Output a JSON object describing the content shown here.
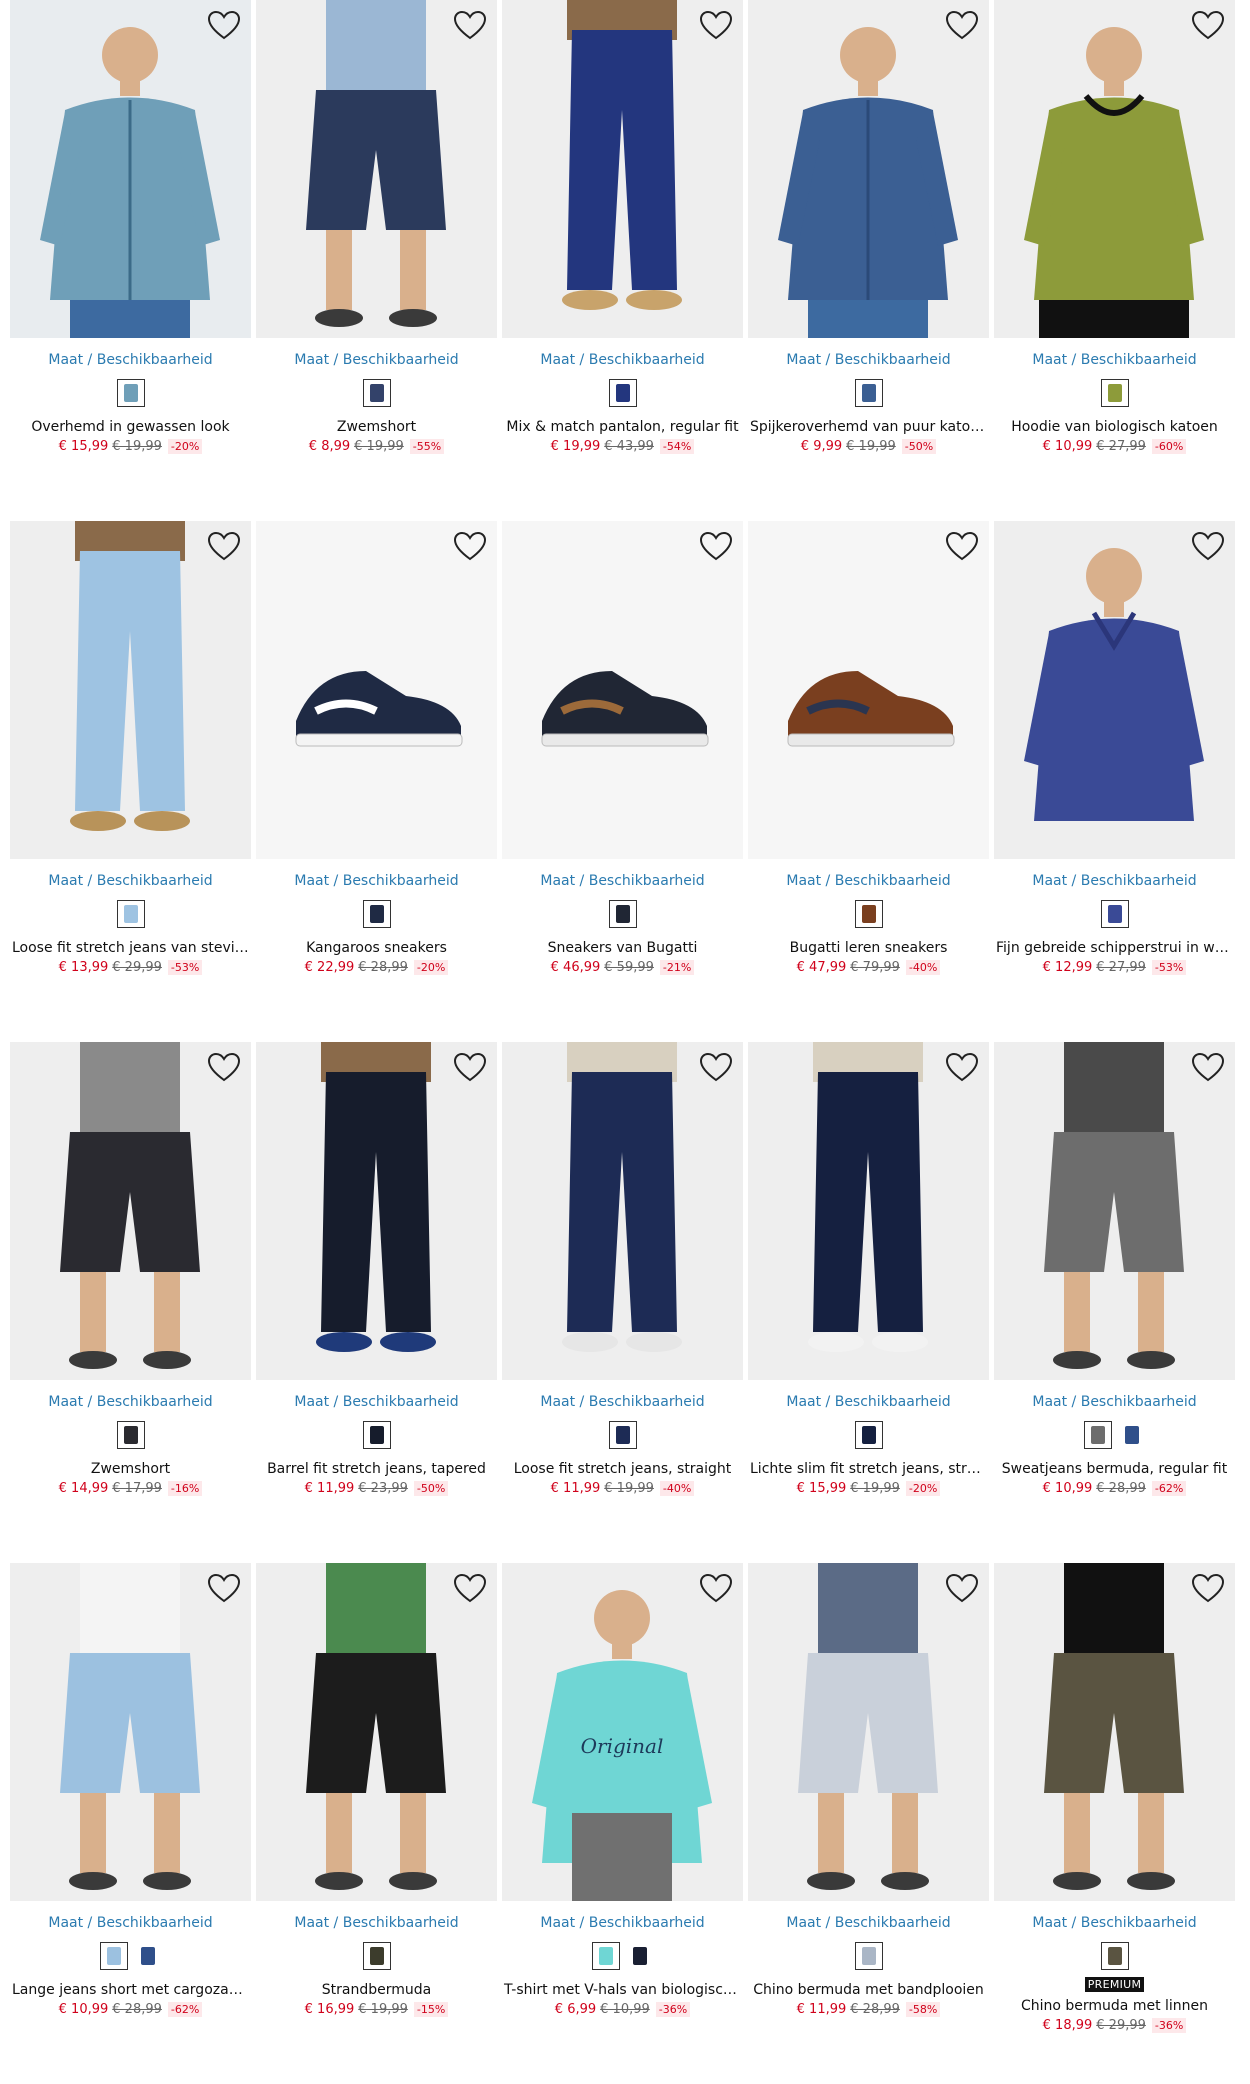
{
  "common": {
    "size_label": "Maat / Beschikbaarheid"
  },
  "products": [
    {
      "name": "Overhemd in gewassen look",
      "price": "€ 15,99",
      "old_price": "€ 19,99",
      "discount": "-20%",
      "kind": "shirt",
      "bg": "#e8ecef",
      "colors": [
        "#6f9fb8",
        "#3b6b88"
      ],
      "swatches": [
        "#6f9fb8"
      ]
    },
    {
      "name": "Zwemshort",
      "price": "€ 8,99",
      "old_price": "€ 19,99",
      "discount": "-55%",
      "kind": "shorts",
      "bg": "#eeeeee",
      "colors": [
        "#2b3a5c",
        "#9bb7d4"
      ],
      "swatches": [
        "#33426a"
      ]
    },
    {
      "name": "Mix & match pantalon, regular fit",
      "price": "€ 19,99",
      "old_price": "€ 43,99",
      "discount": "-54%",
      "kind": "trousers",
      "bg": "#eeeeee",
      "colors": [
        "#23367e",
        "#c8a36b"
      ],
      "swatches": [
        "#23367e"
      ]
    },
    {
      "name": "Spijkeroverhemd van puur katoen, …",
      "price": "€ 9,99",
      "old_price": "€ 19,99",
      "discount": "-50%",
      "kind": "shirt",
      "bg": "#eeeeee",
      "colors": [
        "#3b5f93",
        "#2b4a78"
      ],
      "swatches": [
        "#3b5f93"
      ]
    },
    {
      "name": "Hoodie van biologisch katoen",
      "price": "€ 10,99",
      "old_price": "€ 27,99",
      "discount": "-60%",
      "kind": "hoodie",
      "bg": "#eeeeee",
      "colors": [
        "#8d9b3a",
        "#111111"
      ],
      "swatches": [
        "#8d9b3a"
      ]
    },
    {
      "name": "Loose fit stretch jeans van stevig d…",
      "price": "€ 13,99",
      "old_price": "€ 29,99",
      "discount": "-53%",
      "kind": "jeans",
      "bg": "#eeeeee",
      "colors": [
        "#9ec3e2",
        "#b8935a"
      ],
      "swatches": [
        "#9ec3e2"
      ]
    },
    {
      "name": "Kangaroos sneakers",
      "price": "€ 22,99",
      "old_price": "€ 28,99",
      "discount": "-20%",
      "kind": "sneaker",
      "bg": "#f6f6f6",
      "colors": [
        "#1f2a44",
        "#ffffff"
      ],
      "swatches": [
        "#1f2a44"
      ]
    },
    {
      "name": "Sneakers van Bugatti",
      "price": "€ 46,99",
      "old_price": "€ 59,99",
      "discount": "-21%",
      "kind": "sneaker",
      "bg": "#f6f6f6",
      "colors": [
        "#202634",
        "#9c6a3a"
      ],
      "swatches": [
        "#202634"
      ]
    },
    {
      "name": "Bugatti leren sneakers",
      "price": "€ 47,99",
      "old_price": "€ 79,99",
      "discount": "-40%",
      "kind": "sneaker",
      "bg": "#f6f6f6",
      "colors": [
        "#7a3f1f",
        "#2a3550"
      ],
      "swatches": [
        "#7a3f1f"
      ]
    },
    {
      "name": "Fijn gebreide schipperstrui in wash…",
      "price": "€ 12,99",
      "old_price": "€ 27,99",
      "discount": "-53%",
      "kind": "sweater",
      "bg": "#eeeeee",
      "colors": [
        "#3a4a96",
        "#2b367a"
      ],
      "swatches": [
        "#3a4a96"
      ]
    },
    {
      "name": "Zwemshort",
      "price": "€ 14,99",
      "old_price": "€ 17,99",
      "discount": "-16%",
      "kind": "shorts",
      "bg": "#eeeeee",
      "colors": [
        "#2a2a30",
        "#8a8a8a"
      ],
      "swatches": [
        "#2a2a30"
      ]
    },
    {
      "name": "Barrel fit stretch jeans, tapered",
      "price": "€ 11,99",
      "old_price": "€ 23,99",
      "discount": "-50%",
      "kind": "jeans",
      "bg": "#eeeeee",
      "colors": [
        "#161c2c",
        "#1f3a7a"
      ],
      "swatches": [
        "#161c2c"
      ]
    },
    {
      "name": "Loose fit stretch jeans, straight",
      "price": "€ 11,99",
      "old_price": "€ 19,99",
      "discount": "-40%",
      "kind": "jeans",
      "bg": "#eeeeee",
      "colors": [
        "#1d2b55",
        "#e6e6e6"
      ],
      "swatches": [
        "#1d2b55"
      ]
    },
    {
      "name": "Lichte slim fit stretch jeans, straight",
      "price": "€ 15,99",
      "old_price": "€ 19,99",
      "discount": "-20%",
      "kind": "jeans",
      "bg": "#eeeeee",
      "colors": [
        "#152040",
        "#f2f2f2"
      ],
      "swatches": [
        "#152040"
      ]
    },
    {
      "name": "Sweatjeans bermuda, regular fit",
      "price": "€ 10,99",
      "old_price": "€ 28,99",
      "discount": "-62%",
      "kind": "shorts",
      "bg": "#eeeeee",
      "colors": [
        "#6d6d6d",
        "#4a4a4a"
      ],
      "swatches": [
        "#6d6d6d",
        "#2f4f8a"
      ]
    },
    {
      "name": "Lange jeans short met cargozakken…",
      "price": "€ 10,99",
      "old_price": "€ 28,99",
      "discount": "-62%",
      "kind": "shorts",
      "bg": "#eeeeee",
      "colors": [
        "#9cc1e0",
        "#f4f4f4"
      ],
      "swatches": [
        "#9cc1e0",
        "#2f4f8a"
      ]
    },
    {
      "name": "Strandbermuda",
      "price": "€ 16,99",
      "old_price": "€ 19,99",
      "discount": "-15%",
      "kind": "shorts",
      "bg": "#eeeeee",
      "colors": [
        "#1c1c1c",
        "#4b8a4f"
      ],
      "swatches": [
        "#3c3c2c"
      ]
    },
    {
      "name": "T-shirt met V-hals van biologisch ka…",
      "price": "€ 6,99",
      "old_price": "€ 10,99",
      "discount": "-36%",
      "kind": "tshirt",
      "bg": "#eeeeee",
      "colors": [
        "#6fd6d4",
        "#707070"
      ],
      "swatches": [
        "#6fd6d4",
        "#1a1f33"
      ]
    },
    {
      "name": "Chino bermuda met bandplooien",
      "price": "€ 11,99",
      "old_price": "€ 28,99",
      "discount": "-58%",
      "kind": "shorts",
      "bg": "#eeeeee",
      "colors": [
        "#c9d0da",
        "#5b6b86"
      ],
      "swatches": [
        "#aab6c6"
      ]
    },
    {
      "name": "Chino bermuda met linnen",
      "price": "€ 18,99",
      "old_price": "€ 29,99",
      "discount": "-36%",
      "kind": "shorts",
      "bg": "#eeeeee",
      "colors": [
        "#5a5441",
        "#111111"
      ],
      "swatches": [
        "#5a5441"
      ],
      "premium": "PREMIUM"
    }
  ]
}
